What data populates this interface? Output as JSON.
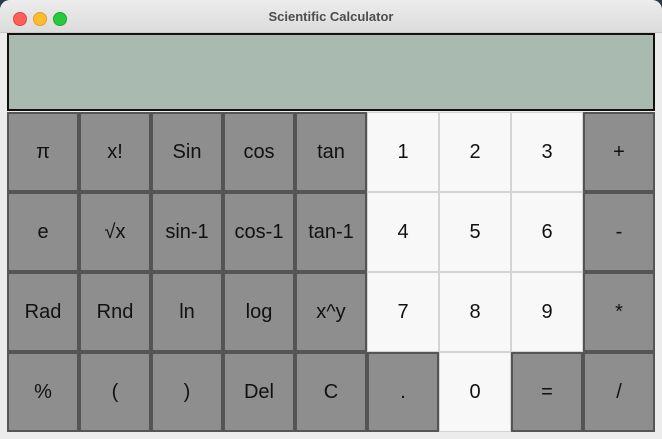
{
  "window": {
    "title": "Scientific Calculator"
  },
  "display": {
    "value": ""
  },
  "keys": [
    [
      {
        "label": "π",
        "name": "pi-key",
        "type": "func"
      },
      {
        "label": "x!",
        "name": "factorial-key",
        "type": "func"
      },
      {
        "label": "Sin",
        "name": "sin-key",
        "type": "func"
      },
      {
        "label": "cos",
        "name": "cos-key",
        "type": "func"
      },
      {
        "label": "tan",
        "name": "tan-key",
        "type": "func"
      },
      {
        "label": "1",
        "name": "digit-1-key",
        "type": "num"
      },
      {
        "label": "2",
        "name": "digit-2-key",
        "type": "num"
      },
      {
        "label": "3",
        "name": "digit-3-key",
        "type": "num"
      },
      {
        "label": "+",
        "name": "add-key",
        "type": "func"
      }
    ],
    [
      {
        "label": "e",
        "name": "euler-key",
        "type": "func"
      },
      {
        "label": "√x",
        "name": "sqrt-key",
        "type": "func"
      },
      {
        "label": "sin-1",
        "name": "asin-key",
        "type": "func"
      },
      {
        "label": "cos-1",
        "name": "acos-key",
        "type": "func"
      },
      {
        "label": "tan-1",
        "name": "atan-key",
        "type": "func"
      },
      {
        "label": "4",
        "name": "digit-4-key",
        "type": "num"
      },
      {
        "label": "5",
        "name": "digit-5-key",
        "type": "num"
      },
      {
        "label": "6",
        "name": "digit-6-key",
        "type": "num"
      },
      {
        "label": "-",
        "name": "subtract-key",
        "type": "func"
      }
    ],
    [
      {
        "label": "Rad",
        "name": "rad-key",
        "type": "func"
      },
      {
        "label": "Rnd",
        "name": "rnd-key",
        "type": "func"
      },
      {
        "label": "ln",
        "name": "ln-key",
        "type": "func"
      },
      {
        "label": "log",
        "name": "log-key",
        "type": "func"
      },
      {
        "label": "x^y",
        "name": "power-key",
        "type": "func"
      },
      {
        "label": "7",
        "name": "digit-7-key",
        "type": "num"
      },
      {
        "label": "8",
        "name": "digit-8-key",
        "type": "num"
      },
      {
        "label": "9",
        "name": "digit-9-key",
        "type": "num"
      },
      {
        "label": "*",
        "name": "multiply-key",
        "type": "func"
      }
    ],
    [
      {
        "label": "%",
        "name": "percent-key",
        "type": "func"
      },
      {
        "label": "(",
        "name": "open-paren-key",
        "type": "func"
      },
      {
        "label": ")",
        "name": "close-paren-key",
        "type": "func"
      },
      {
        "label": "Del",
        "name": "delete-key",
        "type": "func"
      },
      {
        "label": "C",
        "name": "clear-key",
        "type": "func"
      },
      {
        "label": ".",
        "name": "decimal-key",
        "type": "func"
      },
      {
        "label": "0",
        "name": "digit-0-key",
        "type": "num"
      },
      {
        "label": "=",
        "name": "equals-key",
        "type": "func"
      },
      {
        "label": "/",
        "name": "divide-key",
        "type": "func"
      }
    ]
  ]
}
